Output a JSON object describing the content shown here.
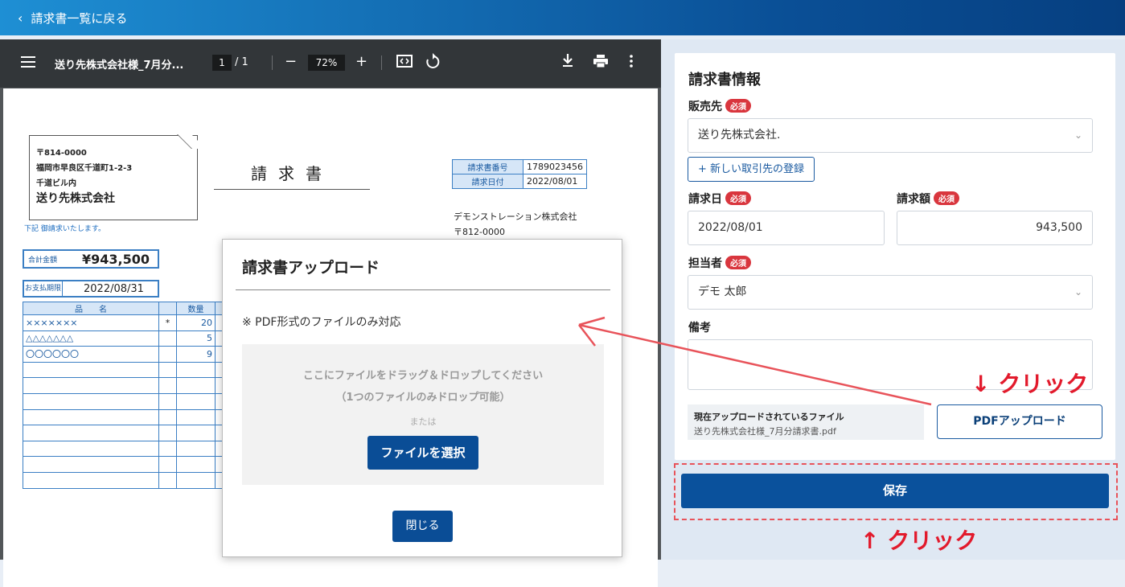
{
  "topbar": {
    "back_label": "請求書一覧に戻る"
  },
  "viewer": {
    "title": "送り先株式会社様_7月分...",
    "page_current": "1",
    "page_sep": "/ 1",
    "zoom": "72%"
  },
  "invoice": {
    "addr_zip": "〒814-0000",
    "addr_line1": "福岡市早良区千道町1-2-3",
    "addr_line2": "千道ビル内",
    "addr_name": "送り先株式会社",
    "heading": "請求書",
    "note": "下記 御請求いたします。",
    "no_label": "請求書番号",
    "no_value": "1789023456",
    "date_label": "請求日付",
    "date_value": "2022/08/01",
    "company_name": "デモンストレーション株式会社",
    "company_zip": "〒812-0000",
    "total_label": "合計金額",
    "total_value": "¥943,500",
    "due_label": "お支払期限",
    "due_value": "2022/08/31",
    "col_item": "品　　名",
    "col_qty": "数量",
    "rows": [
      {
        "name": "×××××××",
        "mark": "*",
        "qty": "20"
      },
      {
        "name": "△△△△△△△",
        "mark": "",
        "qty": "5"
      },
      {
        "name": "〇〇〇〇〇〇",
        "mark": "",
        "qty": "9"
      }
    ]
  },
  "modal": {
    "title": "請求書アップロード",
    "note": "※ PDF形式のファイルのみ対応",
    "drop_line1": "ここにファイルをドラッグ＆ドロップしてください",
    "drop_line2": "（1つのファイルのみドロップ可能）",
    "or": "または",
    "select_button": "ファイルを選択",
    "close_button": "閉じる"
  },
  "form": {
    "heading": "請求書情報",
    "required_badge": "必須",
    "vendor_label": "販売先",
    "vendor_value": "送り先株式会社.",
    "new_vendor_button": "+ 新しい取引先の登録",
    "date_label": "請求日",
    "date_value": "2022/08/01",
    "amount_label": "請求額",
    "amount_value": "943,500",
    "owner_label": "担当者",
    "owner_value": "デモ 太郎",
    "memo_label": "備考",
    "current_file_label": "現在アップロードされているファイル",
    "current_file_name": "送り先株式会社様_7月分請求書.pdf",
    "pdf_upload_button": "PDFアップロード",
    "save_button": "保存"
  },
  "annotations": {
    "click_top": "↓ クリック",
    "click_bottom": "↑ クリック",
    "color": "#e21a2c"
  }
}
